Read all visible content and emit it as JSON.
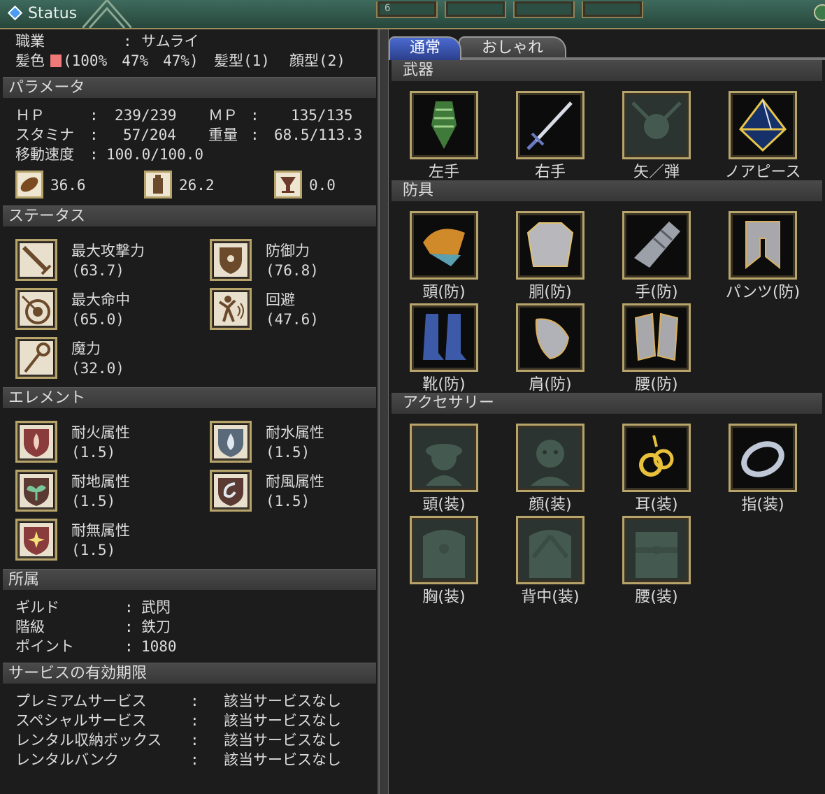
{
  "window": {
    "title": "Status",
    "mini_label": "6"
  },
  "header": {
    "job_label": "職業",
    "job_sep": ":",
    "job_value": "サムライ",
    "hair_color_label": "髪色",
    "hair_color_value": "(100%　47%　47%)",
    "hair_color_swatch": "#f07878",
    "hair_style": "髪型(1)",
    "face_style": "顔型(2)"
  },
  "params": {
    "title": "パラメータ",
    "hp_label": "ＨＰ",
    "hp_value": "239/239",
    "mp_label": "ＭＰ",
    "mp_value": "135/135",
    "stamina_label": "スタミナ",
    "stamina_value": "57/204",
    "weight_label": "重量",
    "weight_value": "68.5/113.3",
    "speed_label": "移動速度",
    "speed_value": "100.0/100.0",
    "colon": ":",
    "food": "36.6",
    "potion": "26.2",
    "drink": "0.0"
  },
  "status": {
    "title": "ステータス",
    "items": [
      {
        "name": "最大攻撃力",
        "value": "(63.7)"
      },
      {
        "name": "防御力",
        "value": "(76.8)"
      },
      {
        "name": "最大命中",
        "value": "(65.0)"
      },
      {
        "name": "回避",
        "value": "(47.6)"
      },
      {
        "name": "魔力",
        "value": "(32.0)"
      }
    ]
  },
  "element": {
    "title": "エレメント",
    "items": [
      {
        "name": "耐火属性",
        "value": "(1.5)"
      },
      {
        "name": "耐水属性",
        "value": "(1.5)"
      },
      {
        "name": "耐地属性",
        "value": "(1.5)"
      },
      {
        "name": "耐風属性",
        "value": "(1.5)"
      },
      {
        "name": "耐無属性",
        "value": "(1.5)"
      }
    ]
  },
  "affiliation": {
    "title": "所属",
    "guild_label": "ギルド",
    "guild_value": "武閃",
    "rank_label": "階級",
    "rank_value": "鉄刀",
    "points_label": "ポイント",
    "points_value": "1080",
    "colon": ":"
  },
  "service": {
    "title": "サービスの有効期限",
    "colon": ":",
    "items": [
      {
        "name": "プレミアムサービス",
        "value": "該当サービスなし"
      },
      {
        "name": "スペシャルサービス",
        "value": "該当サービスなし"
      },
      {
        "name": "レンタル収納ボックス",
        "value": "該当サービスなし"
      },
      {
        "name": "レンタルバンク",
        "value": "該当サービスなし"
      }
    ]
  },
  "tabs": {
    "normal": "通常",
    "fashion": "おしゃれ"
  },
  "weapons": {
    "title": "武器",
    "slots": [
      "左手",
      "右手",
      "矢／弾",
      "ノアピース"
    ]
  },
  "armor": {
    "title": "防具",
    "slots": [
      "頭(防)",
      "胴(防)",
      "手(防)",
      "パンツ(防)",
      "靴(防)",
      "肩(防)",
      "腰(防)"
    ]
  },
  "accessory": {
    "title": "アクセサリー",
    "slots": [
      "頭(装)",
      "顔(装)",
      "耳(装)",
      "指(装)",
      "胸(装)",
      "背中(装)",
      "腰(装)"
    ]
  }
}
